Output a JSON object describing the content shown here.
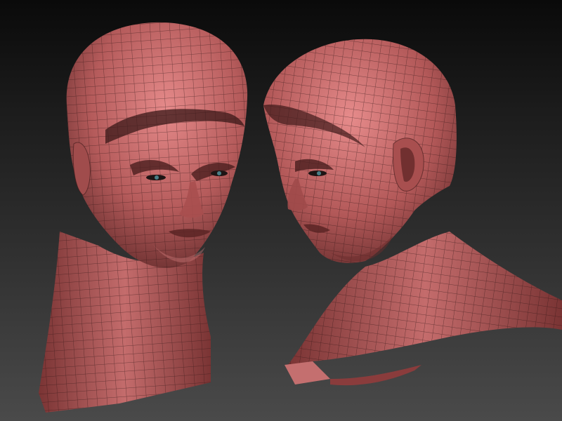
{
  "viewport": {
    "background_top": "#0a0a0a",
    "background_bottom": "#4a4a4a"
  },
  "models": [
    {
      "name": "head-bust-front",
      "surface_color": "#b55b5b",
      "wire_color": "#2e1414"
    },
    {
      "name": "head-bust-side",
      "surface_color": "#b55b5b",
      "wire_color": "#2e1414"
    }
  ]
}
